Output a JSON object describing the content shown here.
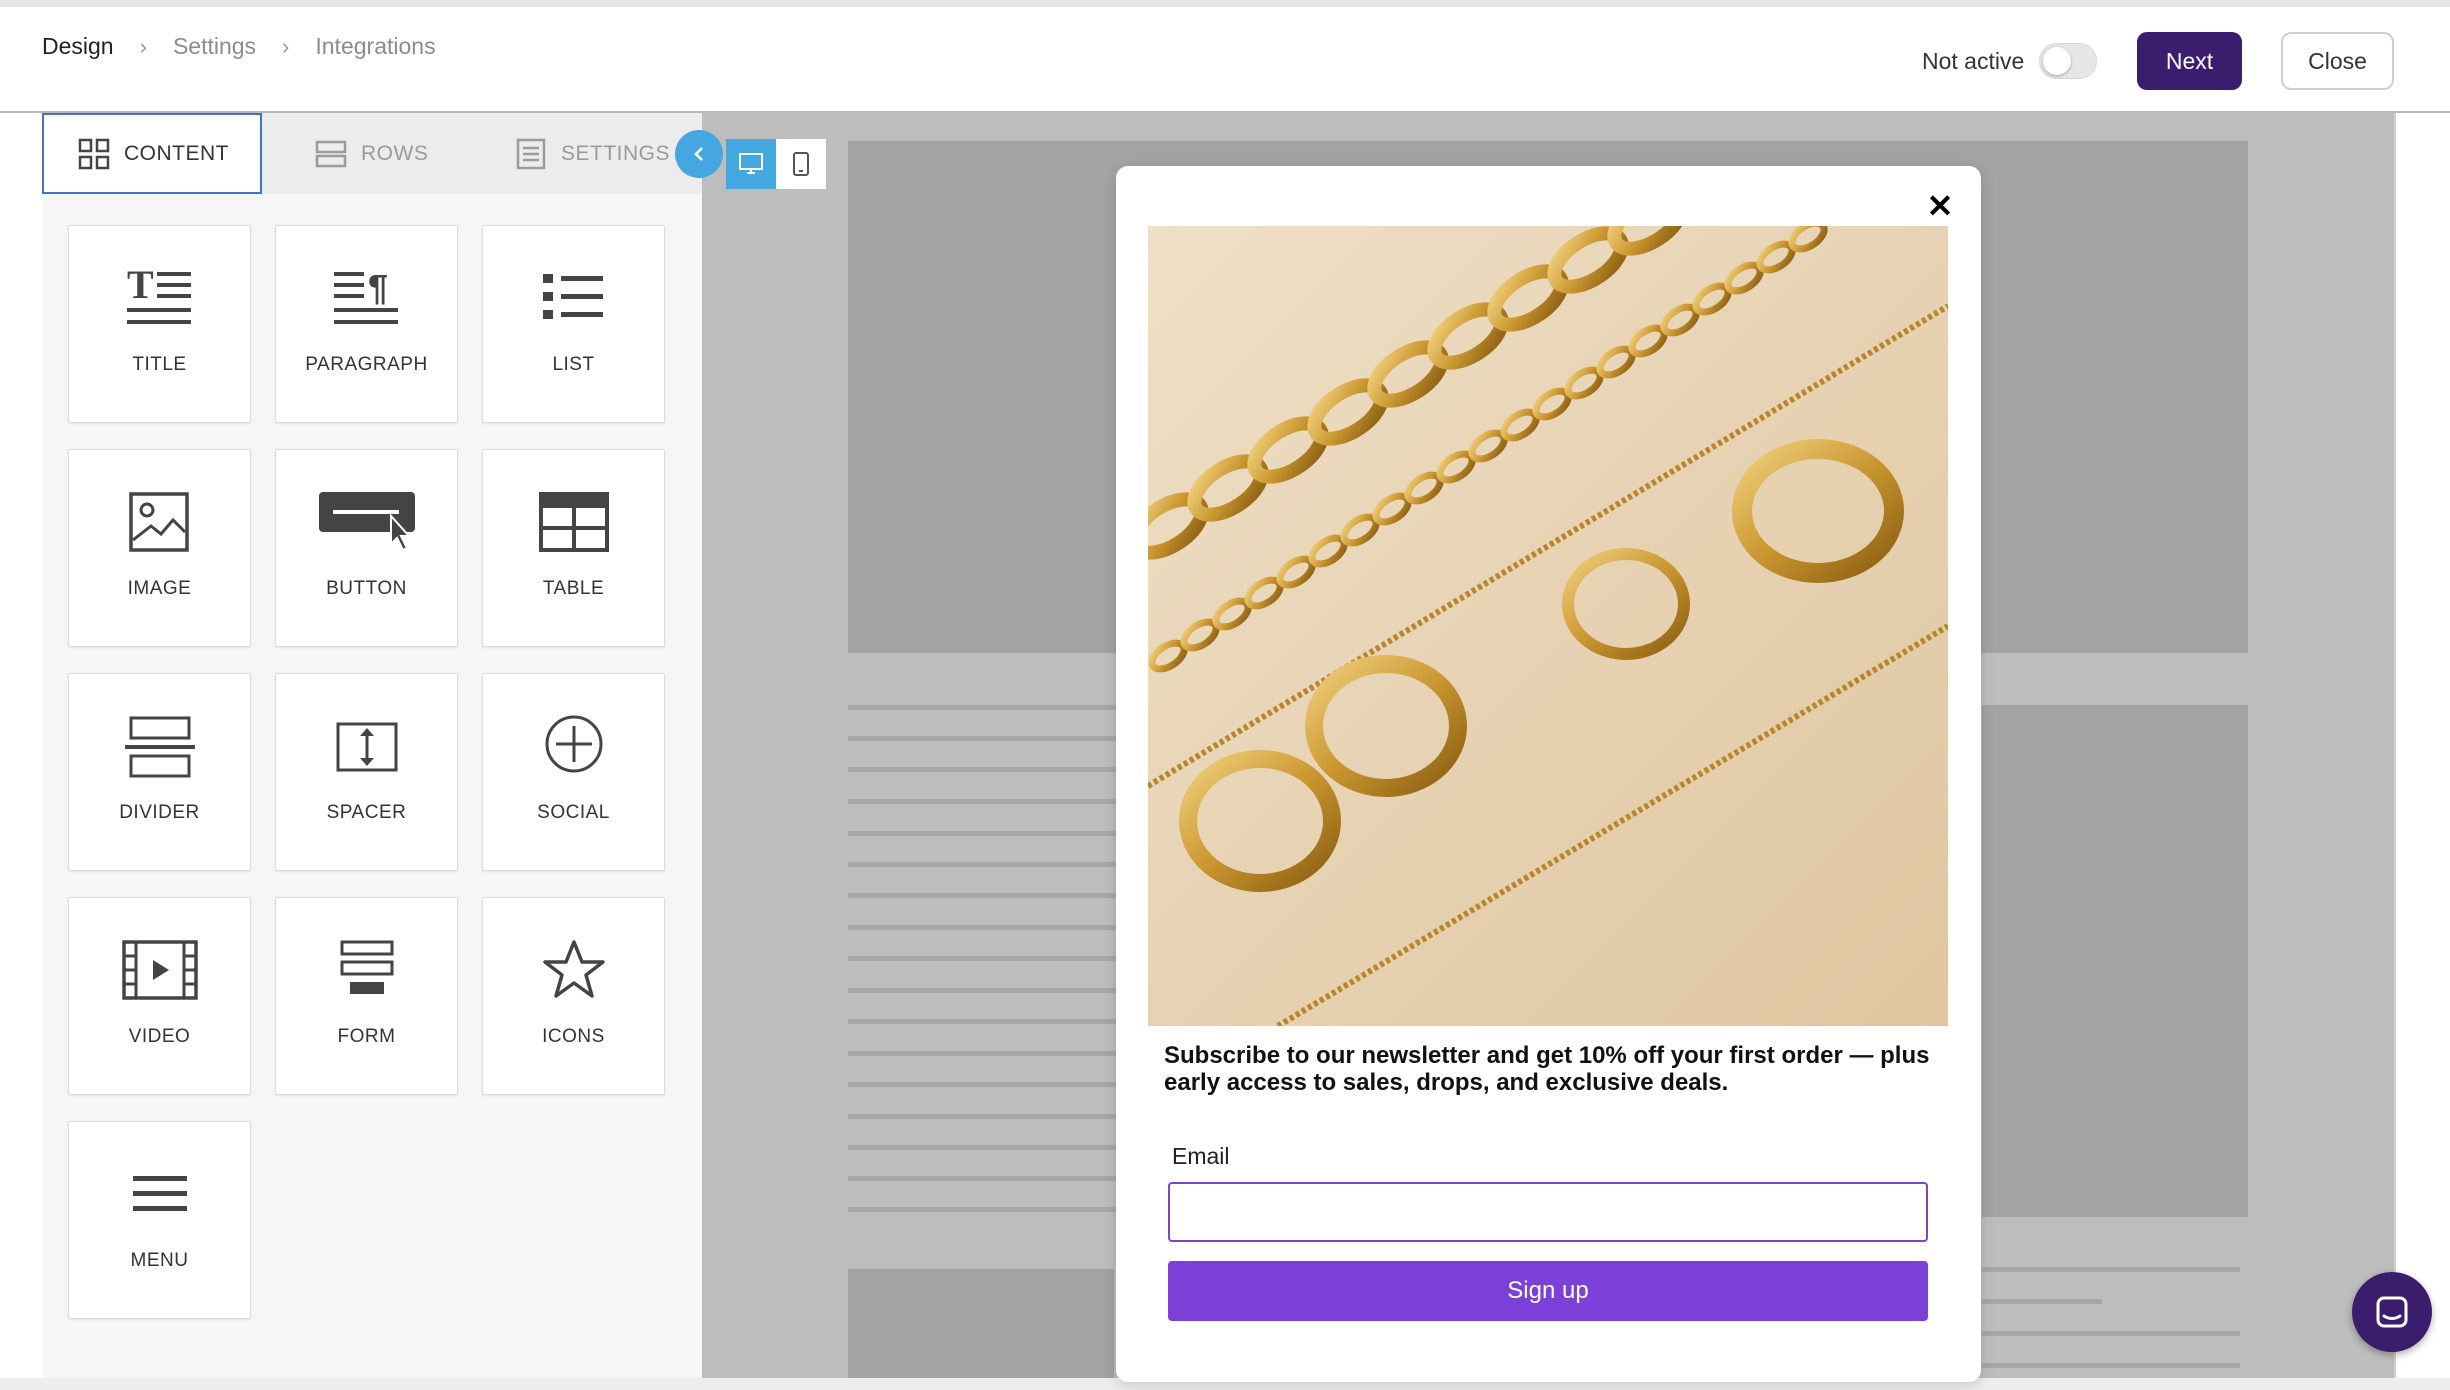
{
  "breadcrumb": {
    "items": [
      "Design",
      "Settings",
      "Integrations"
    ],
    "separator": "›"
  },
  "header": {
    "status_label": "Not active",
    "toggle_on": false,
    "next_label": "Next",
    "close_label": "Close"
  },
  "panel": {
    "tabs": [
      {
        "label": "CONTENT",
        "icon": "grid-icon",
        "active": true
      },
      {
        "label": "ROWS",
        "icon": "rows-icon",
        "active": false
      },
      {
        "label": "SETTINGS",
        "icon": "settings-doc-icon",
        "active": false
      }
    ],
    "tiles": [
      {
        "label": "TITLE",
        "icon": "title-icon"
      },
      {
        "label": "PARAGRAPH",
        "icon": "paragraph-icon"
      },
      {
        "label": "LIST",
        "icon": "list-icon"
      },
      {
        "label": "IMAGE",
        "icon": "image-icon"
      },
      {
        "label": "BUTTON",
        "icon": "button-icon"
      },
      {
        "label": "TABLE",
        "icon": "table-icon"
      },
      {
        "label": "DIVIDER",
        "icon": "divider-icon"
      },
      {
        "label": "SPACER",
        "icon": "spacer-icon"
      },
      {
        "label": "SOCIAL",
        "icon": "social-icon"
      },
      {
        "label": "VIDEO",
        "icon": "video-icon"
      },
      {
        "label": "FORM",
        "icon": "form-icon"
      },
      {
        "label": "ICONS",
        "icon": "star-icon"
      },
      {
        "label": "MENU",
        "icon": "menu-icon"
      }
    ]
  },
  "canvas": {
    "active_device": "desktop"
  },
  "popup": {
    "headline": "Subscribe to our newsletter and get 10% off your first order — plus early access to sales, drops, and exclusive deals.",
    "email_label": "Email",
    "email_value": "",
    "email_placeholder": "",
    "signup_label": "Sign up",
    "image_subject": "gold chains and rings on beige background"
  },
  "colors": {
    "brand_dark": "#3b1d6e",
    "signup_button": "#7c3fd8",
    "accent_blue": "#45a7e0",
    "active_tab_border": "#3f74c7",
    "canvas_background": "#bdbdbd"
  }
}
